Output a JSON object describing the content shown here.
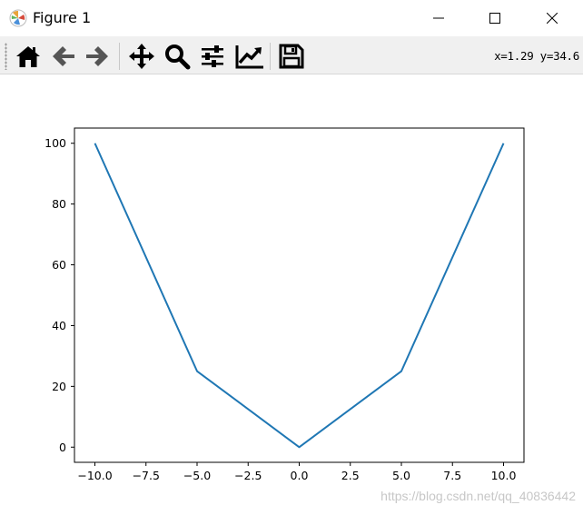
{
  "window": {
    "title": "Figure 1"
  },
  "toolbar": {
    "buttons": [
      {
        "name": "home-icon",
        "label": "Home"
      },
      {
        "name": "back-arrow-icon",
        "label": "Back"
      },
      {
        "name": "forward-arrow-icon",
        "label": "Forward"
      },
      {
        "name": "pan-move-icon",
        "label": "Pan"
      },
      {
        "name": "zoom-magnifier-icon",
        "label": "Zoom"
      },
      {
        "name": "subplots-config-icon",
        "label": "Configure subplots"
      },
      {
        "name": "edit-lines-icon",
        "label": "Edit axis"
      },
      {
        "name": "save-disk-icon",
        "label": "Save"
      }
    ],
    "coords": "x=1.29 y=34.6"
  },
  "watermark": "https://blog.csdn.net/qq_40836442",
  "chart_data": {
    "type": "line",
    "title": "",
    "xlabel": "",
    "ylabel": "",
    "x": [
      -10,
      -5,
      0,
      5,
      10
    ],
    "series": [
      {
        "values": [
          100,
          25,
          0,
          25,
          100
        ],
        "color": "#1f77b4"
      }
    ],
    "xlim": [
      -11,
      11
    ],
    "ylim": [
      -5,
      105
    ],
    "xticks": [
      -10.0,
      -7.5,
      -5.0,
      -2.5,
      0.0,
      2.5,
      5.0,
      7.5,
      10.0
    ],
    "xtick_labels": [
      "−10.0",
      "−7.5",
      "−5.0",
      "−2.5",
      "0.0",
      "2.5",
      "5.0",
      "7.5",
      "10.0"
    ],
    "yticks": [
      0,
      20,
      40,
      60,
      80,
      100
    ],
    "ytick_labels": [
      "0",
      "20",
      "40",
      "60",
      "80",
      "100"
    ],
    "grid": false,
    "legend": "none"
  }
}
